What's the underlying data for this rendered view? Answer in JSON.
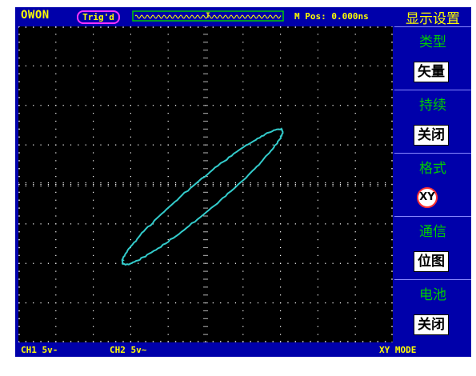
{
  "header": {
    "brand": "OWON",
    "trigger_status": "Trig'd",
    "trigger_marker": "T",
    "m_pos": "M Pos: 0.000ns"
  },
  "menu": {
    "title": "显示设置",
    "items": [
      {
        "label": "类型",
        "value": "矢量"
      },
      {
        "label": "持续",
        "value": "关闭"
      },
      {
        "label": "格式",
        "value": "XY"
      },
      {
        "label": "通信",
        "value": "位图"
      },
      {
        "label": "电池",
        "value": "关闭"
      }
    ]
  },
  "status": {
    "ch1": "CH1 5v-",
    "ch2": "CH2 5v~",
    "mode": "XY MODE"
  },
  "colors": {
    "background": "#0000aa",
    "text": "#ffff00",
    "menu_label": "#00cc00",
    "trace": "#33cccc",
    "grid": "#ffffff",
    "highlight": "#ff3333"
  },
  "waveform": {
    "shape": "ellipse",
    "orientation": "tilted ~45deg rising to the right"
  }
}
